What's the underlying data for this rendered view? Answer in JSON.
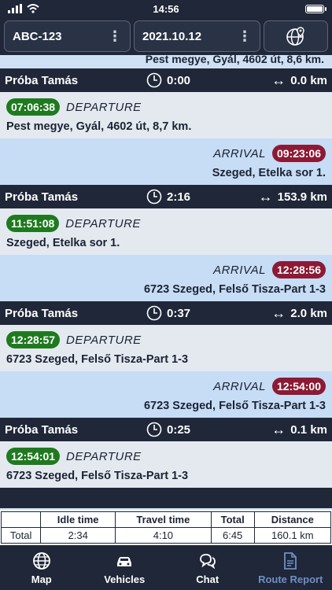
{
  "status_bar": {
    "time": "14:56"
  },
  "top_bar": {
    "vehicle": "ABC-123",
    "date": "2021.10.12",
    "map_icon": "globe-pin-icon"
  },
  "list": {
    "partial_address": "Pest megye, Gyál, 4602 út, 8,6 km.",
    "summary_1": {
      "driver": "Próba Tamás",
      "idle": "0:00",
      "distance": "0.0 km"
    },
    "dep_1": {
      "time": "07:06:38",
      "label": "DEPARTURE",
      "address": "Pest megye, Gyál, 4602 út, 8,7 km."
    },
    "arr_1": {
      "time": "09:23:06",
      "label": "ARRIVAL",
      "address": "Szeged, Etelka sor 1."
    },
    "summary_2": {
      "driver": "Próba Tamás",
      "idle": "2:16",
      "distance": "153.9 km"
    },
    "dep_2": {
      "time": "11:51:08",
      "label": "DEPARTURE",
      "address": "Szeged, Etelka sor 1."
    },
    "arr_2": {
      "time": "12:28:56",
      "label": "ARRIVAL",
      "address": "6723 Szeged, Felső Tisza-Part 1-3"
    },
    "summary_3": {
      "driver": "Próba Tamás",
      "idle": "0:37",
      "distance": "2.0 km"
    },
    "dep_3": {
      "time": "12:28:57",
      "label": "DEPARTURE",
      "address": "6723 Szeged, Felső Tisza-Part 1-3"
    },
    "arr_3": {
      "time": "12:54:00",
      "label": "ARRIVAL",
      "address": "6723 Szeged, Felső Tisza-Part 1-3"
    },
    "summary_4": {
      "driver": "Próba Tamás",
      "idle": "0:25",
      "distance": "0.1 km"
    },
    "dep_4": {
      "time": "12:54:01",
      "label": "DEPARTURE",
      "address": "6723 Szeged, Felső Tisza-Part 1-3"
    }
  },
  "totals": {
    "headers": [
      "",
      "Idle time",
      "Travel time",
      "Total",
      "Distance"
    ],
    "row": [
      "Total",
      "2:34",
      "4:10",
      "6:45",
      "160.1 km"
    ]
  },
  "tabs": [
    {
      "label": "Map",
      "icon": "globe-icon"
    },
    {
      "label": "Vehicles",
      "icon": "car-icon"
    },
    {
      "label": "Chat",
      "icon": "chat-icon"
    },
    {
      "label": "Route Report",
      "icon": "document-icon"
    }
  ],
  "colors": {
    "background": "#1f2738",
    "departure_badge": "#1f7a1f",
    "arrival_badge": "#8c1a34",
    "active_tab": "#6f8fc9"
  }
}
